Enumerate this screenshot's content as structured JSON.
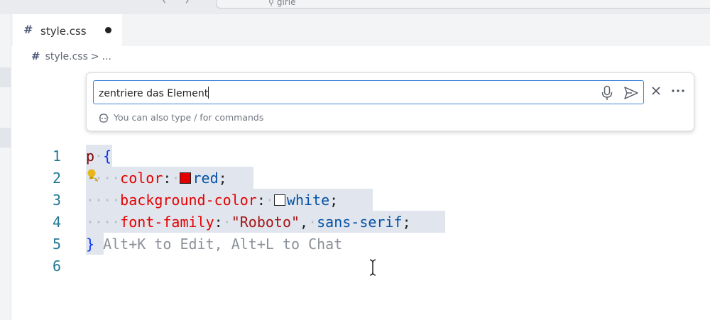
{
  "titlebar": {
    "command_center_text": "girie",
    "nav_back_icon": "chevron-left-icon",
    "nav_forward_icon": "chevron-right-icon"
  },
  "tab": {
    "icon": "#",
    "label": "style.css",
    "dirty_indicator": "unsaved-dot-icon"
  },
  "breadcrumb": {
    "icon": "#",
    "file": "style.css",
    "separator": ">",
    "more": "..."
  },
  "chat": {
    "input_value": "zentriere das Element",
    "hint": "You can also type / for commands",
    "icons": [
      "microphone-icon",
      "send-icon",
      "close-icon",
      "more-icon",
      "copilot-icon"
    ]
  },
  "editor": {
    "line_numbers": [
      "1",
      "2",
      "3",
      "4",
      "5",
      "6"
    ],
    "lines": {
      "l1_selector": "p",
      "l1_brace": "{",
      "l2_prop": "color",
      "l2_value": "red",
      "l3_prop": "background-color",
      "l3_value": "white",
      "l4_prop": "font-family",
      "l4_string": "\"Roboto\"",
      "l4_value": "sans-serif",
      "l5_brace": "}",
      "l5_ghost": "Alt+K to Edit, Alt+L to Chat"
    },
    "swatches": {
      "red": "#e50000",
      "white": "#ffffff"
    }
  },
  "colors": {
    "accent": "#3f86d7",
    "selection": "#e1e6ee",
    "line_number": "#237893"
  }
}
